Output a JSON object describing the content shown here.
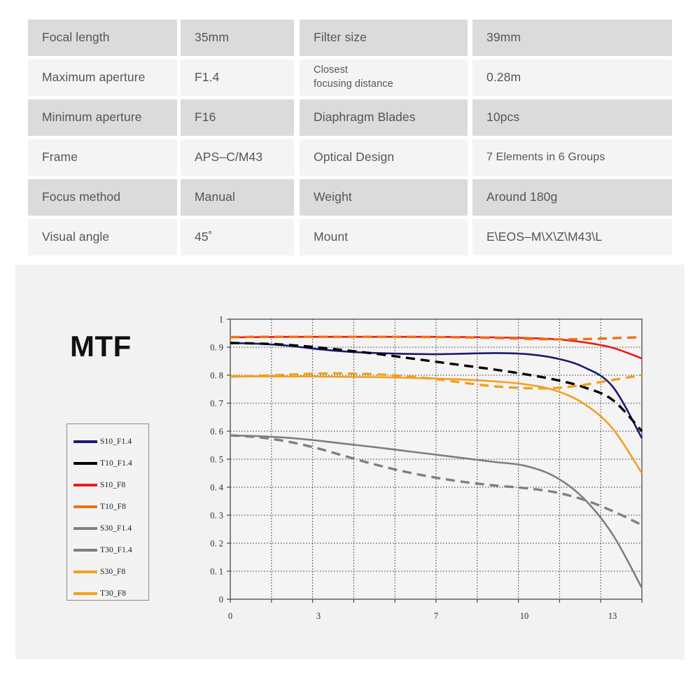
{
  "spec_table": {
    "rows": [
      {
        "shade": "dark",
        "label1": "Focal length",
        "value1": "35mm",
        "label2": "Filter size",
        "value2": "39mm"
      },
      {
        "shade": "light",
        "label1": "Maximum aperture",
        "value1": "F1.4",
        "label2": "Closest\nfocusing distance",
        "value2": "0.28m"
      },
      {
        "shade": "dark",
        "label1": "Minimum aperture",
        "value1": "F16",
        "label2": "Diaphragm Blades",
        "value2": "10pcs"
      },
      {
        "shade": "light",
        "label1": "Frame",
        "value1": "APS–C/M43",
        "label2": "Optical Design",
        "value2": "7 Elements in 6 Groups"
      },
      {
        "shade": "dark",
        "label1": "Focus method",
        "value1": "Manual",
        "label2": "Weight",
        "value2": "Around 180g"
      },
      {
        "shade": "light",
        "label1": "Visual angle",
        "value1": "45˚",
        "label2": "Mount",
        "value2": "E\\EOS–M\\X\\Z\\M43\\L"
      }
    ]
  },
  "mtf": {
    "title": "MTF",
    "legend": [
      {
        "label": "S10_F1.4",
        "color": "#1a1a6e",
        "dash": false
      },
      {
        "label": "T10_F1.4",
        "color": "#000000",
        "dash": false
      },
      {
        "label": "S10_F8",
        "color": "#ee1a12",
        "dash": false
      },
      {
        "label": "T10_F8",
        "color": "#ef7112",
        "dash": false
      },
      {
        "label": "S30_F1.4",
        "color": "#7f7f7f",
        "dash": false
      },
      {
        "label": "T30_F1.4",
        "color": "#7f7f7f",
        "dash": false
      },
      {
        "label": "S30_F8",
        "color": "#f2a01e",
        "dash": false
      },
      {
        "label": "T30_F8",
        "color": "#f2a01e",
        "dash": false
      }
    ]
  },
  "chart_data": {
    "type": "line",
    "title": "MTF",
    "xlabel": "",
    "ylabel": "",
    "xlim": [
      0,
      14
    ],
    "ylim": [
      0,
      1
    ],
    "grid": true,
    "legend_position": "left",
    "x_ticks": [
      0,
      3,
      7,
      10,
      13
    ],
    "x_tick_labels": [
      "0",
      "3",
      "7",
      "10",
      "13"
    ],
    "x_gridlines": [
      0,
      1.4,
      2.8,
      4.2,
      5.6,
      7.0,
      8.4,
      9.8,
      11.2,
      12.6,
      14.0
    ],
    "y_ticks": [
      0,
      0.1,
      0.2,
      0.3,
      0.4,
      0.5,
      0.6,
      0.7,
      0.8,
      0.9,
      1
    ],
    "y_tick_labels": [
      "0",
      "0. 1",
      "0. 2",
      "0. 3",
      "0. 4",
      "0. 5",
      "0. 6",
      "0. 7",
      "0. 8",
      "0. 9",
      "1"
    ],
    "x": [
      0,
      1,
      2,
      3,
      4,
      5,
      6,
      7,
      8,
      9,
      10,
      11,
      12,
      13,
      14
    ],
    "series": [
      {
        "name": "S10_F1.4",
        "color": "#1a1a6e",
        "style": "solid",
        "values": [
          0.915,
          0.912,
          0.905,
          0.893,
          0.884,
          0.879,
          0.876,
          0.875,
          0.877,
          0.879,
          0.876,
          0.862,
          0.83,
          0.76,
          0.575
        ]
      },
      {
        "name": "T10_F1.4",
        "color": "#000000",
        "style": "dashed",
        "values": [
          0.915,
          0.913,
          0.908,
          0.899,
          0.888,
          0.876,
          0.862,
          0.848,
          0.834,
          0.82,
          0.804,
          0.785,
          0.758,
          0.712,
          0.6
        ]
      },
      {
        "name": "S10_F8",
        "color": "#ee1a12",
        "style": "solid",
        "values": [
          0.935,
          0.936,
          0.937,
          0.937,
          0.937,
          0.937,
          0.937,
          0.937,
          0.936,
          0.935,
          0.933,
          0.929,
          0.918,
          0.898,
          0.86
        ]
      },
      {
        "name": "T10_F8",
        "color": "#ef7112",
        "style": "dashed",
        "values": [
          0.936,
          0.937,
          0.937,
          0.937,
          0.937,
          0.937,
          0.937,
          0.936,
          0.935,
          0.933,
          0.93,
          0.928,
          0.929,
          0.932,
          0.936
        ]
      },
      {
        "name": "S30_F1.4",
        "color": "#7f7f7f",
        "style": "solid",
        "values": [
          0.585,
          0.582,
          0.576,
          0.566,
          0.554,
          0.542,
          0.529,
          0.516,
          0.503,
          0.49,
          0.477,
          0.44,
          0.362,
          0.232,
          0.04
        ]
      },
      {
        "name": "T30_F1.4",
        "color": "#7f7f7f",
        "style": "dashed",
        "values": [
          0.585,
          0.578,
          0.562,
          0.538,
          0.508,
          0.479,
          0.454,
          0.434,
          0.418,
          0.406,
          0.397,
          0.383,
          0.356,
          0.315,
          0.265
        ]
      },
      {
        "name": "S30_F8",
        "color": "#f2a01e",
        "style": "solid",
        "values": [
          0.795,
          0.795,
          0.795,
          0.795,
          0.794,
          0.793,
          0.791,
          0.788,
          0.784,
          0.778,
          0.768,
          0.747,
          0.7,
          0.61,
          0.45
        ]
      },
      {
        "name": "T30_F8",
        "color": "#f2a01e",
        "style": "dashed",
        "values": [
          0.795,
          0.798,
          0.802,
          0.806,
          0.806,
          0.803,
          0.796,
          0.786,
          0.772,
          0.76,
          0.754,
          0.754,
          0.765,
          0.783,
          0.8
        ]
      }
    ]
  }
}
